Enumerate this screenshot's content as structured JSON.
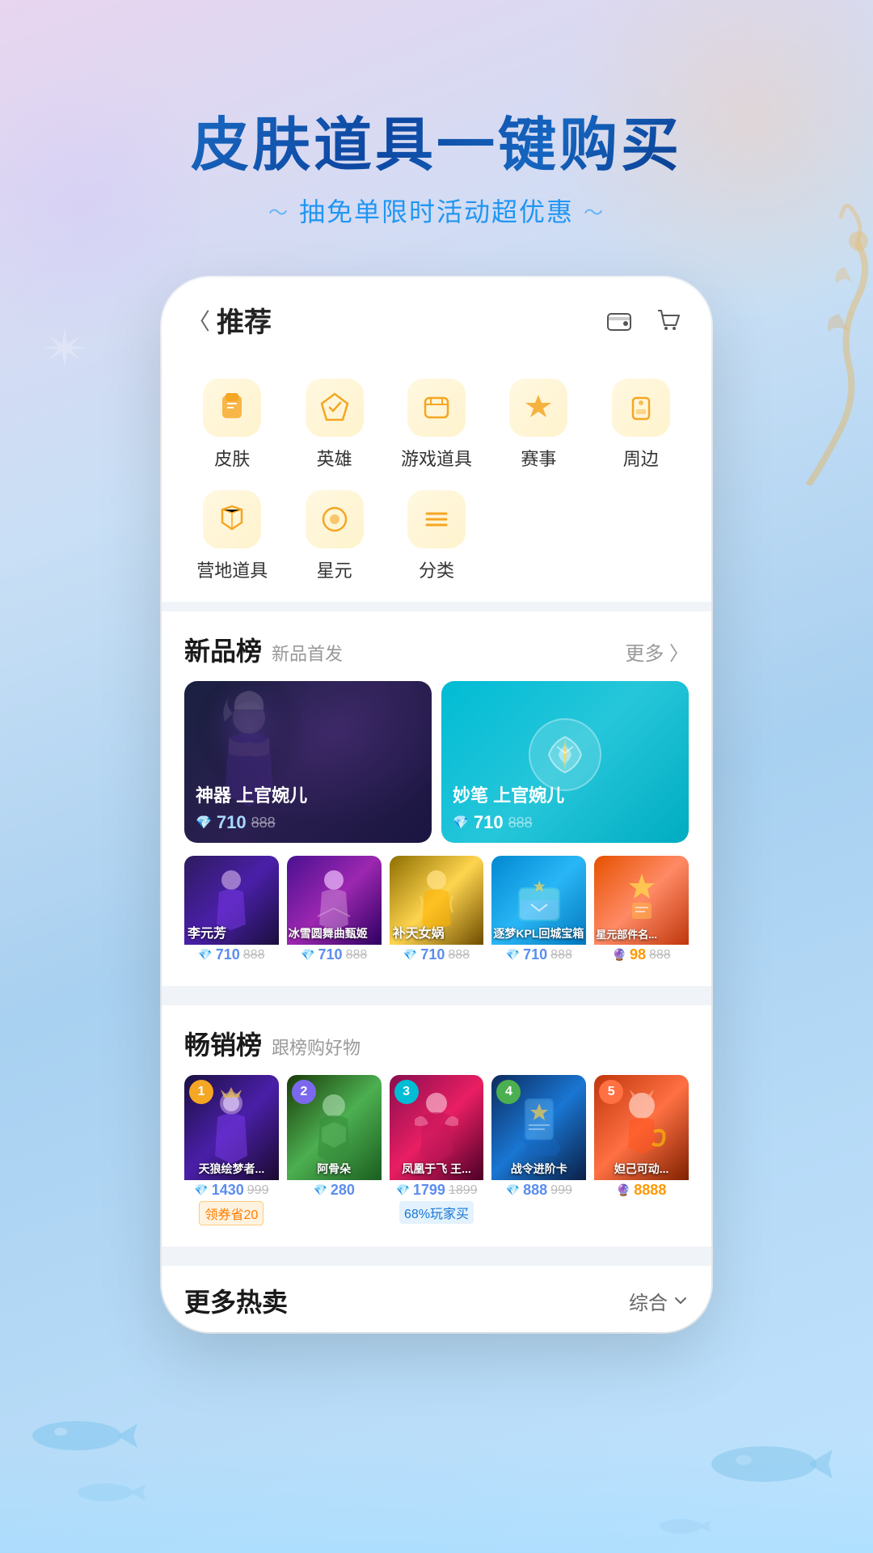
{
  "hero": {
    "title": "皮肤道具一键购买",
    "subtitle": "抽免单限时活动超优惠"
  },
  "header": {
    "back_label": "〈",
    "title": "推荐",
    "icon1": "wallet",
    "icon2": "cart"
  },
  "categories": [
    {
      "label": "皮肤",
      "icon": "👕"
    },
    {
      "label": "英雄",
      "icon": "⚔️"
    },
    {
      "label": "游戏道具",
      "icon": "🎁"
    },
    {
      "label": "赛事",
      "icon": "🏆"
    },
    {
      "label": "周边",
      "icon": "🔒"
    },
    {
      "label": "营地道具",
      "icon": "🎀"
    },
    {
      "label": "星元",
      "icon": "⭕"
    },
    {
      "label": "分类",
      "icon": "≡"
    }
  ],
  "new_products": {
    "section_title": "新品榜",
    "section_subtitle": "新品首发",
    "more_label": "更多 〉",
    "featured": [
      {
        "title": "神器 上官婉儿",
        "price": "710",
        "original_price": "888",
        "bg": "dark"
      },
      {
        "title": "妙笔 上官婉儿",
        "price": "710",
        "original_price": "888",
        "bg": "teal"
      }
    ],
    "small_items": [
      {
        "name": "李元芳",
        "price": "710",
        "orig": "888",
        "bg": "purple-dark"
      },
      {
        "name": "冰雪圆舞曲甄姬",
        "price": "710",
        "orig": "888",
        "bg": "purple-mid"
      },
      {
        "name": "补天女娲",
        "price": "710",
        "orig": "888",
        "bg": "golden"
      },
      {
        "name": "逐梦KPL回城宝箱",
        "price": "710",
        "orig": "888",
        "bg": "cyan-bright"
      },
      {
        "name": "星元部件名称星元部...",
        "price": "98",
        "orig": "888",
        "bg": "orange"
      }
    ]
  },
  "bestseller": {
    "section_title": "畅销榜",
    "section_subtitle": "跟榜购好物",
    "items": [
      {
        "rank": "1",
        "name": "天狼绘梦者...",
        "price": "1430",
        "orig": "999",
        "tag": "领券省20",
        "bg": "purple-dark"
      },
      {
        "rank": "2",
        "name": "阿骨朵",
        "price": "280",
        "orig": "",
        "tag": "",
        "bg": "green-gold"
      },
      {
        "rank": "3",
        "name": "凤凰于飞 王...",
        "price": "1799",
        "orig": "1899",
        "tag": "68%玩家买",
        "bg": "pink"
      },
      {
        "rank": "4",
        "name": "战令进阶卡",
        "price": "888",
        "orig": "999",
        "tag": "",
        "bg": "blue-mid"
      },
      {
        "rank": "5",
        "name": "妲己可动...",
        "price": "8888",
        "orig": "",
        "tag": "",
        "bg": "orange"
      }
    ]
  },
  "more_hot": {
    "title": "更多热卖",
    "sort_label": "综合",
    "sort_icon": "chevron-down"
  }
}
